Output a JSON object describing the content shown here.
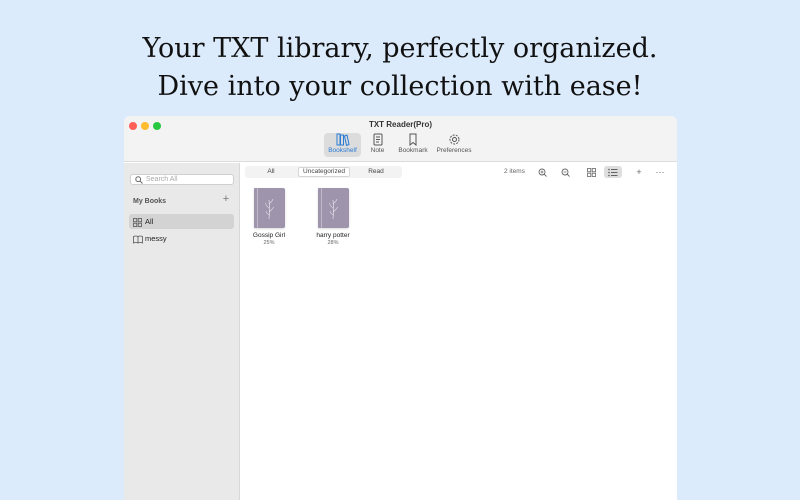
{
  "headline": {
    "line1": "Your TXT library, perfectly organized.",
    "line2": "Dive into your collection with ease!"
  },
  "window": {
    "title": "TXT Reader(Pro)",
    "toolbar": [
      {
        "label": "Bookshelf",
        "icon": "bookshelf-icon",
        "active": true
      },
      {
        "label": "Note",
        "icon": "note-icon"
      },
      {
        "label": "Bookmark",
        "icon": "bookmark-icon"
      },
      {
        "label": "Preferences",
        "icon": "gear-icon"
      }
    ]
  },
  "sidebar": {
    "search_placeholder": "Search All",
    "section_title": "My Books",
    "items": [
      {
        "label": "All",
        "icon": "grid-icon",
        "selected": true
      },
      {
        "label": "messy",
        "icon": "book-open-icon"
      }
    ]
  },
  "filters": {
    "tabs": [
      "All",
      "Uncategorized",
      "Read"
    ],
    "selected": "Uncategorized"
  },
  "library": {
    "item_count": "2 items",
    "view_mode": "list",
    "books": [
      {
        "title": "Gossip Girl",
        "progress": "25%"
      },
      {
        "title": "harry potter",
        "progress": "28%"
      }
    ]
  },
  "colors": {
    "background": "#dcebfb",
    "accent": "#2a7bd6",
    "cover": "#9e94ac"
  }
}
